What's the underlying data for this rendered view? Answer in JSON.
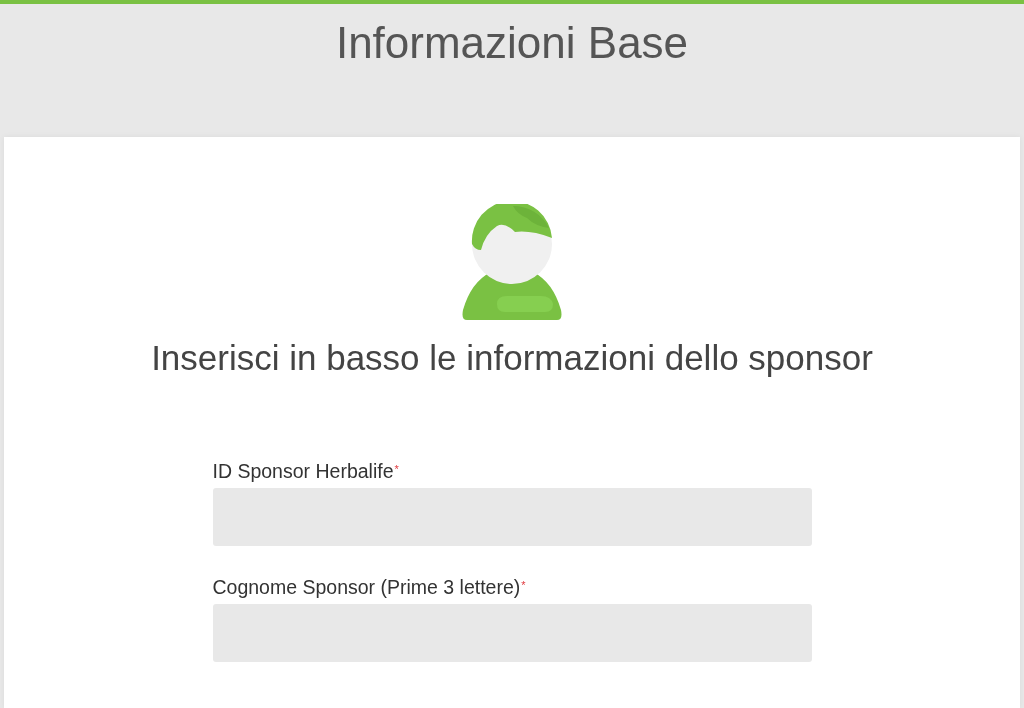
{
  "header": {
    "title": "Informazioni Base"
  },
  "card": {
    "heading": "Inserisci in basso le informazioni dello sponsor",
    "fields": [
      {
        "label": "ID Sponsor Herbalife",
        "required_mark": "*"
      },
      {
        "label": "Cognome Sponsor (Prime 3 lettere)",
        "required_mark": "*"
      }
    ]
  }
}
